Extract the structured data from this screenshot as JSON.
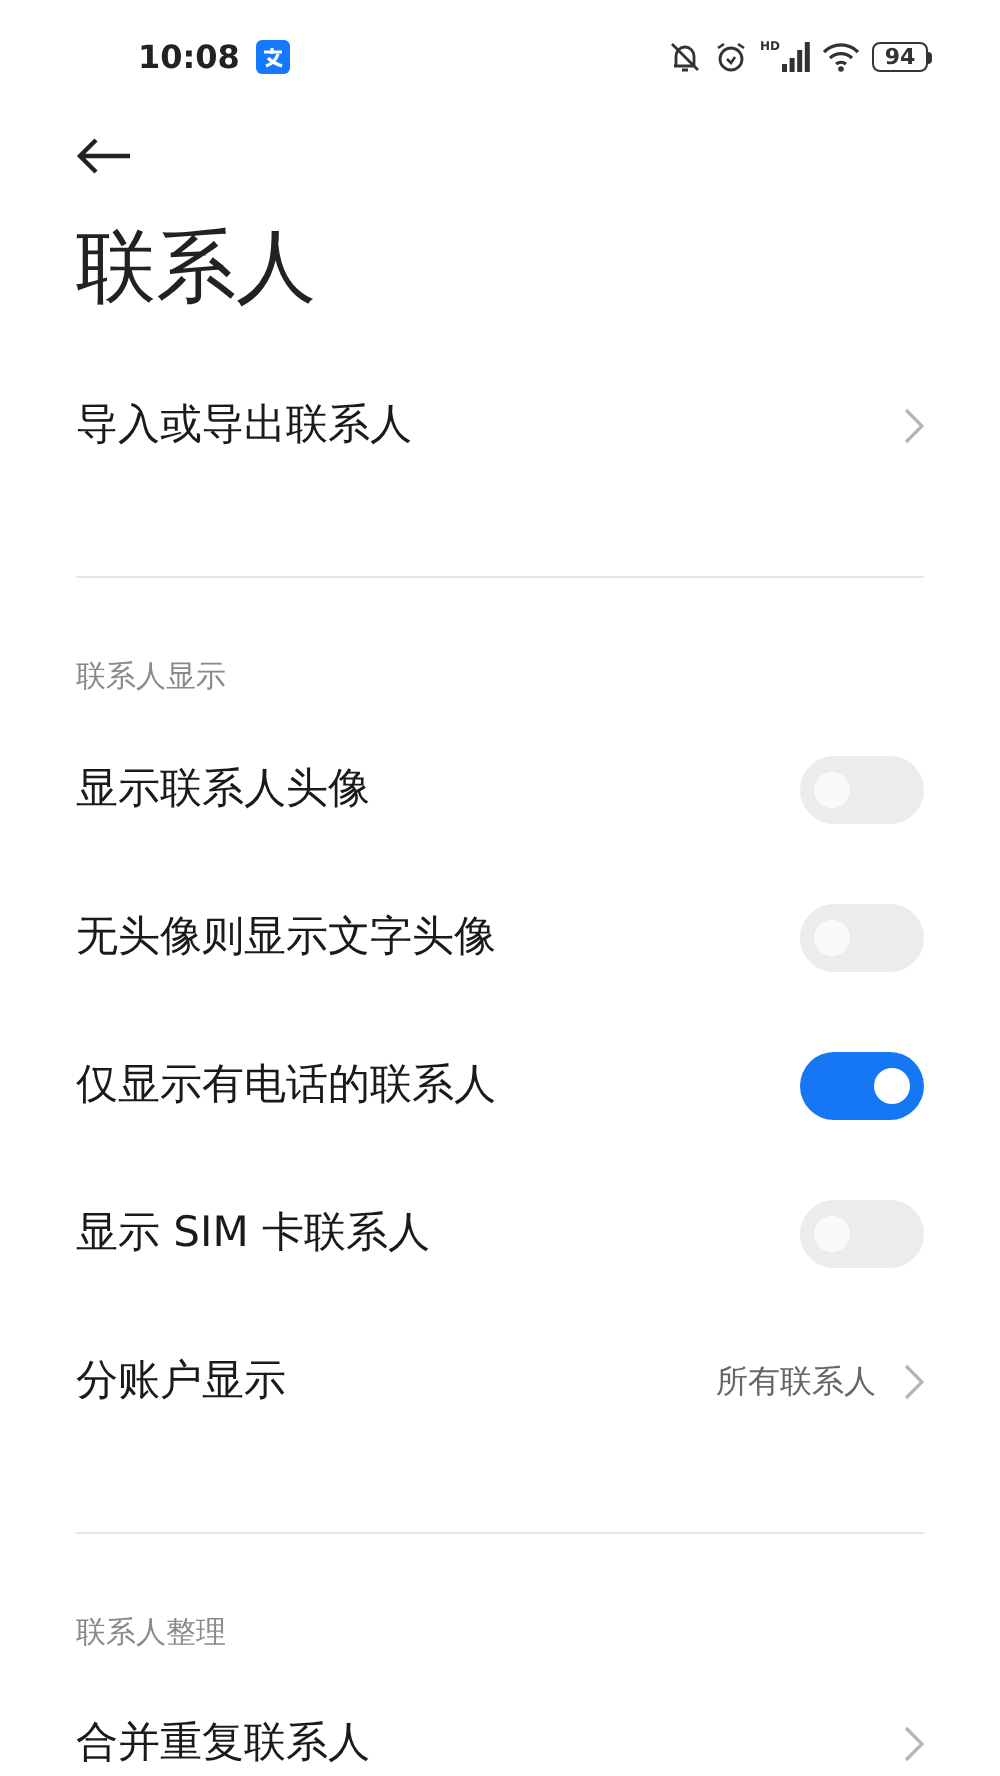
{
  "status_bar": {
    "time": "10:08",
    "signal_label": "HD",
    "battery": "94"
  },
  "title": "联系人",
  "sections": [
    {
      "rows": [
        {
          "kind": "link",
          "label": "导入或导出联系人"
        }
      ]
    },
    {
      "header": "联系人显示",
      "rows": [
        {
          "kind": "toggle",
          "label": "显示联系人头像",
          "on": false
        },
        {
          "kind": "toggle",
          "label": "无头像则显示文字头像",
          "on": false
        },
        {
          "kind": "toggle",
          "label": "仅显示有电话的联系人",
          "on": true
        },
        {
          "kind": "toggle",
          "label": "显示 SIM 卡联系人",
          "on": false
        },
        {
          "kind": "link",
          "label": "分账户显示",
          "value": "所有联系人"
        }
      ]
    },
    {
      "header": "联系人整理",
      "rows": [
        {
          "kind": "link",
          "label": "合并重复联系人"
        }
      ]
    }
  ]
}
